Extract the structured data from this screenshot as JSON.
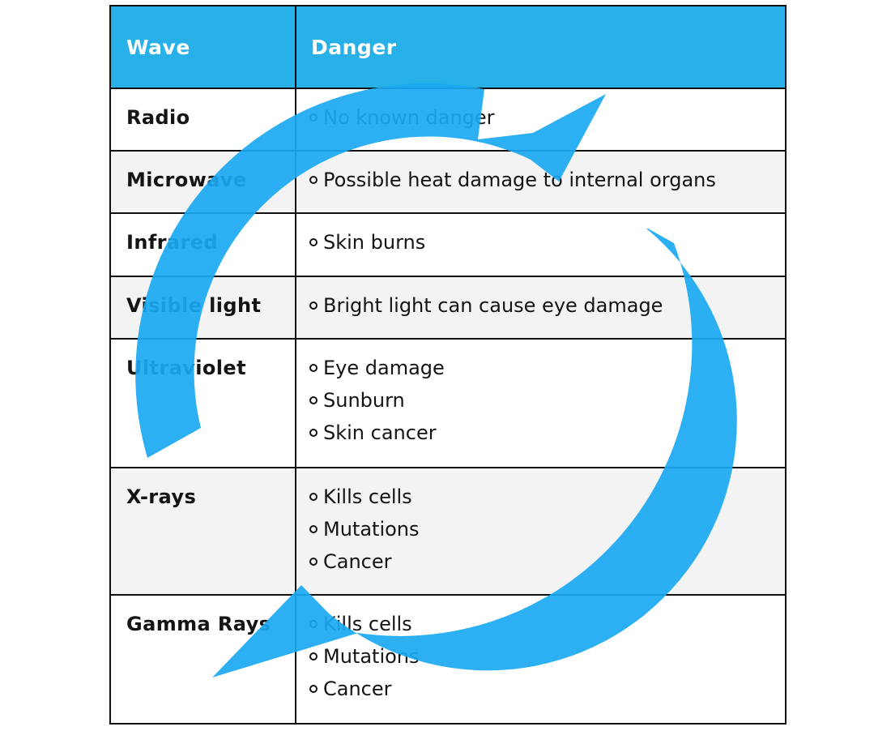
{
  "table": {
    "headers": {
      "wave": "Wave",
      "danger": "Danger"
    },
    "rows": [
      {
        "wave": "Radio",
        "dangers": [
          "No known danger"
        ]
      },
      {
        "wave": "Microwave",
        "dangers": [
          "Possible heat damage to internal organs"
        ]
      },
      {
        "wave": "Infrared",
        "dangers": [
          "Skin burns"
        ]
      },
      {
        "wave": "Visible light",
        "dangers": [
          "Bright light can cause eye damage"
        ]
      },
      {
        "wave": "Ultraviolet",
        "dangers": [
          "Eye damage",
          "Sunburn",
          "Skin cancer"
        ]
      },
      {
        "wave": "X-rays",
        "dangers": [
          "Kills cells",
          "Mutations",
          "Cancer"
        ]
      },
      {
        "wave": "Gamma Rays",
        "dangers": [
          "Kills cells",
          "Mutations",
          "Cancer"
        ]
      }
    ]
  },
  "colors": {
    "header_background": "#27b1e8",
    "header_text": "#ffffff",
    "stripe_background": "#f3f3f3",
    "watermark": "#1aa9f2"
  },
  "icons": {
    "watermark": "circular-arrows-icon"
  }
}
